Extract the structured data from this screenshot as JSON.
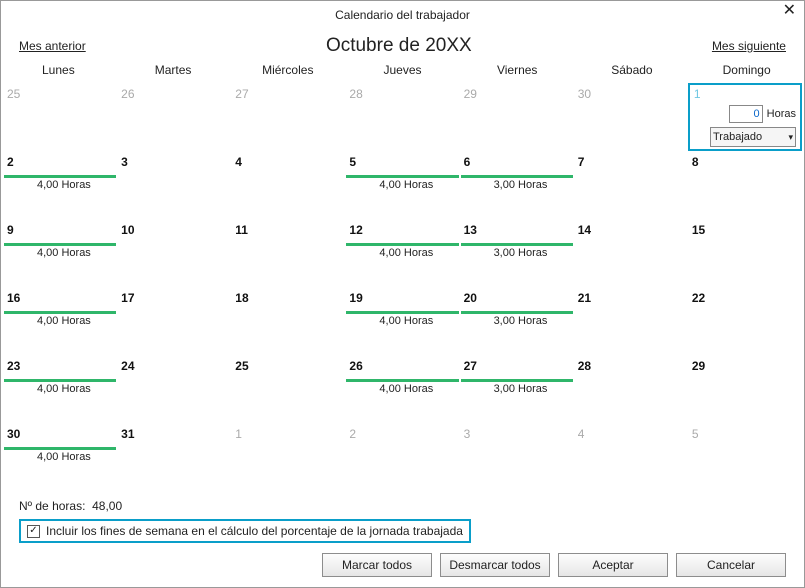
{
  "window": {
    "title": "Calendario del trabajador",
    "close": "✕"
  },
  "nav": {
    "prev": "Mes anterior",
    "title": "Octubre de 20XX",
    "next": "Mes siguiente"
  },
  "dow": [
    "Lunes",
    "Martes",
    "Miércoles",
    "Jueves",
    "Viernes",
    "Sábado",
    "Domingo"
  ],
  "edit": {
    "hours_value": "0",
    "hours_label": "Horas",
    "status": "Trabajado"
  },
  "days": [
    {
      "n": "25",
      "out": true
    },
    {
      "n": "26",
      "out": true
    },
    {
      "n": "27",
      "out": true
    },
    {
      "n": "28",
      "out": true
    },
    {
      "n": "29",
      "out": true
    },
    {
      "n": "30",
      "out": true
    },
    {
      "n": "1",
      "selected": true
    },
    {
      "n": "2",
      "bar": true,
      "hours": "4,00 Horas"
    },
    {
      "n": "3"
    },
    {
      "n": "4"
    },
    {
      "n": "5",
      "bar": true,
      "hours": "4,00 Horas"
    },
    {
      "n": "6",
      "bar": true,
      "hours": "3,00 Horas"
    },
    {
      "n": "7"
    },
    {
      "n": "8"
    },
    {
      "n": "9",
      "bar": true,
      "hours": "4,00 Horas"
    },
    {
      "n": "10"
    },
    {
      "n": "11"
    },
    {
      "n": "12",
      "bar": true,
      "hours": "4,00 Horas"
    },
    {
      "n": "13",
      "bar": true,
      "hours": "3,00 Horas"
    },
    {
      "n": "14"
    },
    {
      "n": "15"
    },
    {
      "n": "16",
      "bar": true,
      "hours": "4,00 Horas"
    },
    {
      "n": "17"
    },
    {
      "n": "18"
    },
    {
      "n": "19",
      "bar": true,
      "hours": "4,00 Horas"
    },
    {
      "n": "20",
      "bar": true,
      "hours": "3,00 Horas"
    },
    {
      "n": "21"
    },
    {
      "n": "22"
    },
    {
      "n": "23",
      "bar": true,
      "hours": "4,00 Horas"
    },
    {
      "n": "24"
    },
    {
      "n": "25"
    },
    {
      "n": "26",
      "bar": true,
      "hours": "4,00 Horas"
    },
    {
      "n": "27",
      "bar": true,
      "hours": "3,00 Horas"
    },
    {
      "n": "28"
    },
    {
      "n": "29"
    },
    {
      "n": "30",
      "bar": true,
      "hours": "4,00 Horas"
    },
    {
      "n": "31"
    },
    {
      "n": "1",
      "out": true
    },
    {
      "n": "2",
      "out": true
    },
    {
      "n": "3",
      "out": true
    },
    {
      "n": "4",
      "out": true
    },
    {
      "n": "5",
      "out": true
    }
  ],
  "total": {
    "label": "Nº de horas:",
    "value": "48,00"
  },
  "checkbox": {
    "checked": true,
    "mark": "✓",
    "label": "Incluir los fines de semana en el cálculo del porcentaje de la jornada trabajada"
  },
  "buttons": {
    "mark_all": "Marcar todos",
    "unmark_all": "Desmarcar todos",
    "ok": "Aceptar",
    "cancel": "Cancelar"
  }
}
